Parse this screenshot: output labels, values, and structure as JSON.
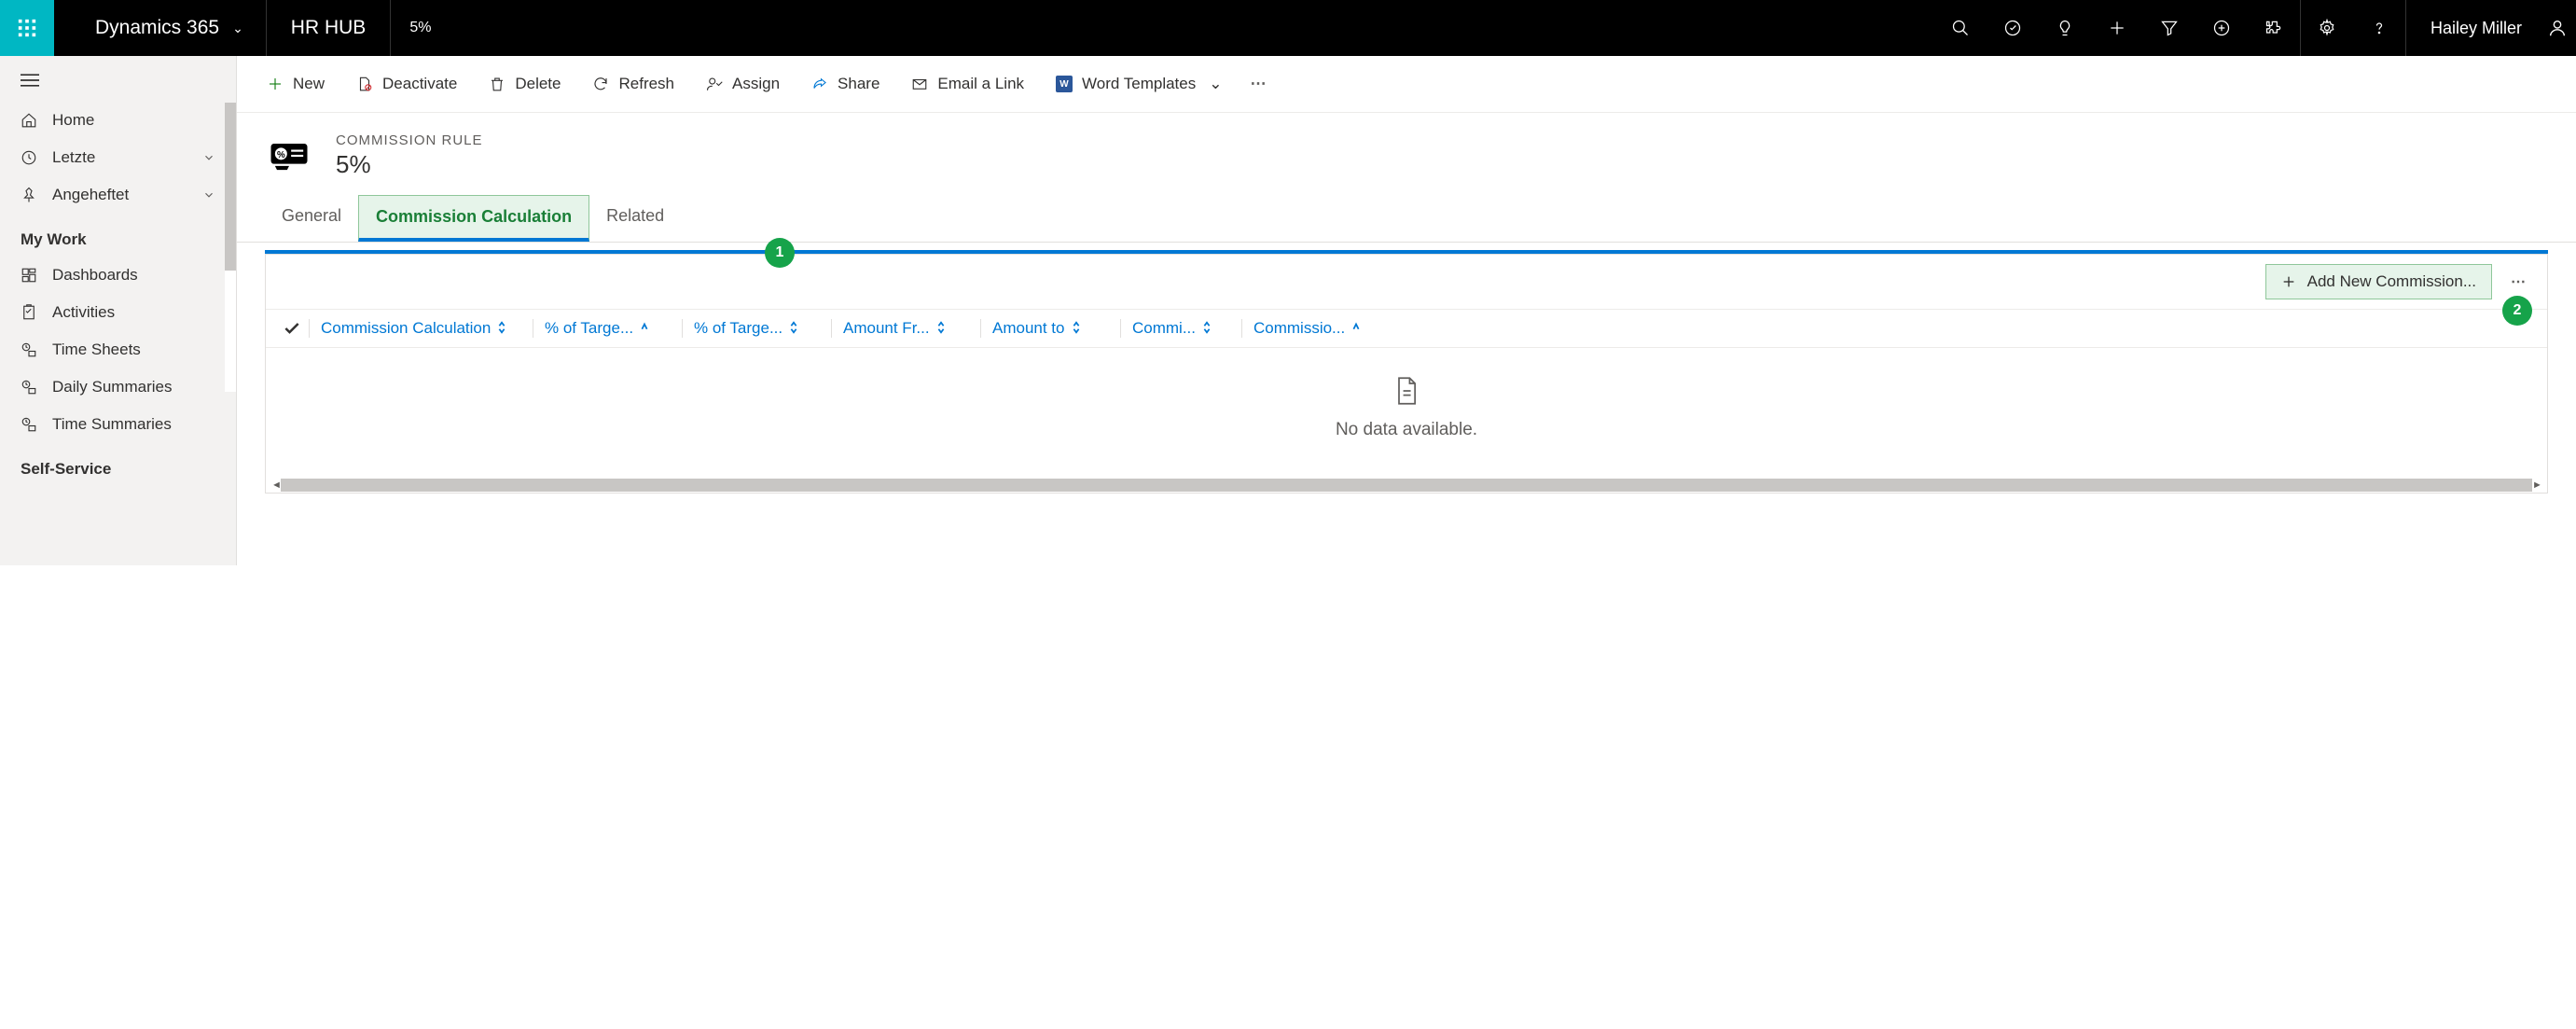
{
  "topbar": {
    "brand": "Dynamics 365",
    "app": "HR HUB",
    "breadcrumb": "5%",
    "user": "Hailey Miller"
  },
  "sidebar": {
    "home": "Home",
    "recent": "Letzte",
    "pinned": "Angeheftet",
    "section_work": "My Work",
    "dashboards": "Dashboards",
    "activities": "Activities",
    "timesheets": "Time Sheets",
    "daily": "Daily Summaries",
    "timesum": "Time Summaries",
    "section_self": "Self-Service"
  },
  "commands": {
    "new": "New",
    "deactivate": "Deactivate",
    "delete": "Delete",
    "refresh": "Refresh",
    "assign": "Assign",
    "share": "Share",
    "email": "Email a Link",
    "word": "Word Templates"
  },
  "record": {
    "entity": "COMMISSION RULE",
    "name": "5%"
  },
  "tabs": {
    "general": "General",
    "calc": "Commission Calculation",
    "related": "Related"
  },
  "badges": {
    "one": "1",
    "two": "2"
  },
  "subgrid": {
    "add": "Add New Commission...",
    "columns": {
      "c1": "Commission Calculation",
      "c2": "% of Targe...",
      "c3": "% of Targe...",
      "c4": "Amount Fr...",
      "c5": "Amount to",
      "c6": "Commi...",
      "c7": "Commissio..."
    },
    "empty": "No data available."
  }
}
